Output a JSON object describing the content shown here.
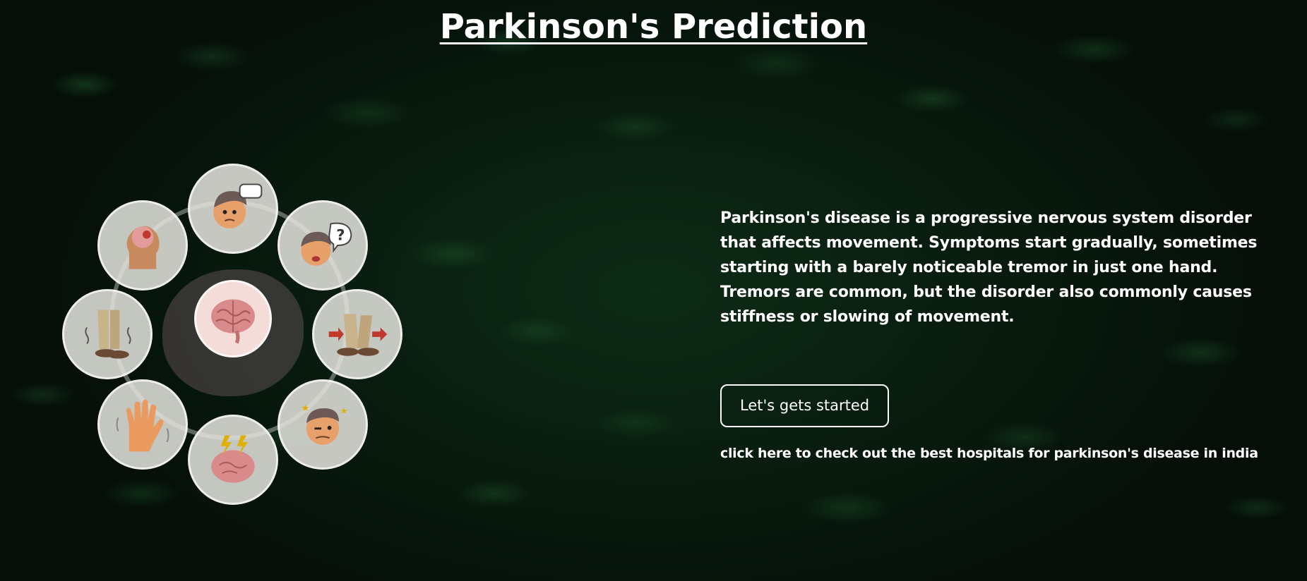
{
  "page": {
    "title": "Parkinson's Prediction"
  },
  "illustration": {
    "symptoms": [
      {
        "icon": "brain-head-icon"
      },
      {
        "icon": "confused-man-icon"
      },
      {
        "icon": "question-man-icon"
      },
      {
        "icon": "walking-feet-icon"
      },
      {
        "icon": "dizzy-man-icon"
      },
      {
        "icon": "brain-lightning-icon"
      },
      {
        "icon": "shaking-hand-icon"
      },
      {
        "icon": "trembling-legs-icon"
      }
    ],
    "center_icon": "brain-icon"
  },
  "content": {
    "description": "Parkinson's disease is a progressive nervous system disorder that affects movement. Symptoms start gradually, sometimes starting with a barely noticeable tremor in just one hand. Tremors are common, but the disorder also commonly causes stiffness or slowing of movement.",
    "start_button_label": "Let's gets started",
    "hospital_link_text": "click here to check out the best hospitals for parkinson's disease in india"
  },
  "colors": {
    "background": "#0b1a10",
    "text": "#ffffff",
    "brain": "#d98a8a"
  }
}
